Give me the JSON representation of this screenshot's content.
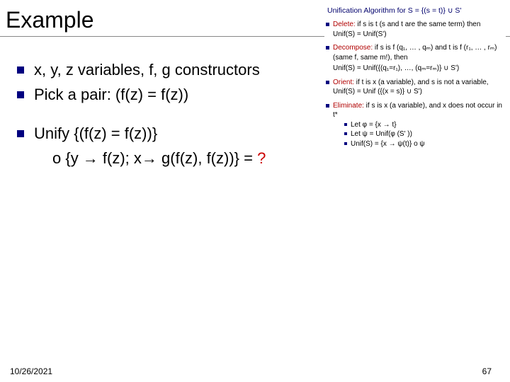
{
  "title": "Example",
  "bullets": {
    "b1": "x, y, z variables, f, g constructors",
    "b2": "Pick a pair: (f(z) = f(z))",
    "b3": "Unify {(f(z) = f(z))}",
    "b3sub": "o {y → f(z); x→ g(f(z), f(z))} = ",
    "b3q": "?"
  },
  "footer": {
    "date": "10/26/2021",
    "page": "67"
  },
  "ref": {
    "title": "Unification Algorithm for S = {(s = t)} ∪ S'",
    "delete_kw": "Delete:",
    "delete_txt": " if s is t (s and t are the same term) then Unif(S) = Unif(S')",
    "decomp_kw": "Decompose:",
    "decomp_txt": " if s is f (q₁, … , qₘ) and t is f (r₁, … , rₘ) (same f, same m!), then",
    "decomp_sub": "Unif(S) = Unif({(q₁=r₁), …, (qₘ=rₘ)} ∪ S')",
    "orient_kw": "Orient:",
    "orient_txt": " if t is x (a variable), and s is not a variable, Unif(S) = Unif ({(x = s)} ∪ S')",
    "elim_kw": "Eliminate:",
    "elim_txt": " if s is x (a variable), and x does not occur in t*",
    "elim_s1": "Let φ = {x → t}",
    "elim_s2": "Let ψ = Unif(φ (S'  ))",
    "elim_s3": "Unif(S) = {x → ψ(t)} o ψ"
  }
}
